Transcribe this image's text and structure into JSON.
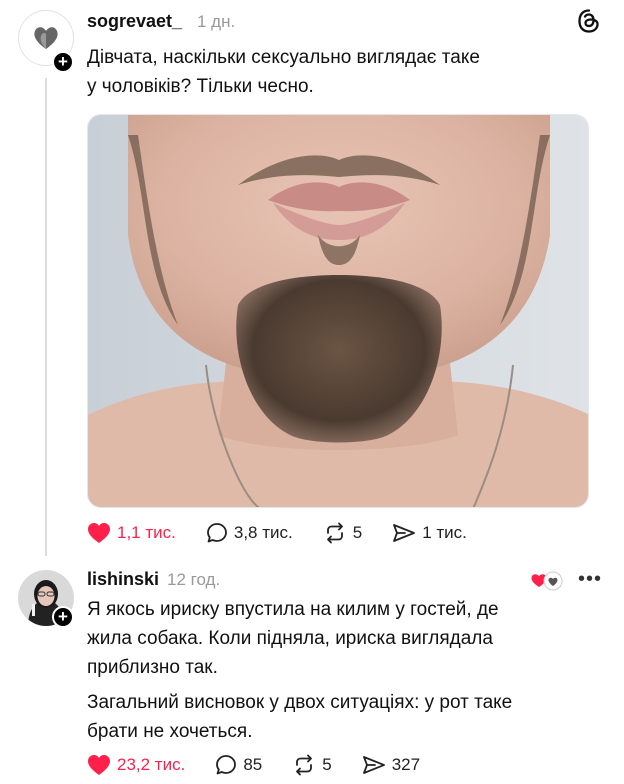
{
  "post": {
    "username": "sogrevaet_",
    "time": "1 дн.",
    "text_line1": "Дівчата, наскільки сексуально виглядає таке",
    "text_line2": "у чоловіків? Тільки чесно.",
    "likes": "1,1 тис.",
    "comments": "3,8 тис.",
    "reposts": "5",
    "shares": "1 тис."
  },
  "comment": {
    "username": "lishinski",
    "time": "12 год.",
    "para1_line1": "Я якось ириску впустила на килим у гостей, де",
    "para1_line2": "жила собака. Коли підняла, ириска виглядала",
    "para1_line3": "приблизно так.",
    "para2_line1": "Загальний висновок у двох ситуаціях: у рот таке",
    "para2_line2": "брати не хочеться.",
    "likes": "23,2 тис.",
    "comments": "85",
    "reposts": "5",
    "shares": "327"
  },
  "colors": {
    "like": "#ff1f4b",
    "muted": "#999999"
  },
  "icons": [
    "heart-icon",
    "comment-icon",
    "repost-icon",
    "share-icon",
    "threads-logo-icon",
    "more-icon",
    "follow-plus-icon"
  ]
}
